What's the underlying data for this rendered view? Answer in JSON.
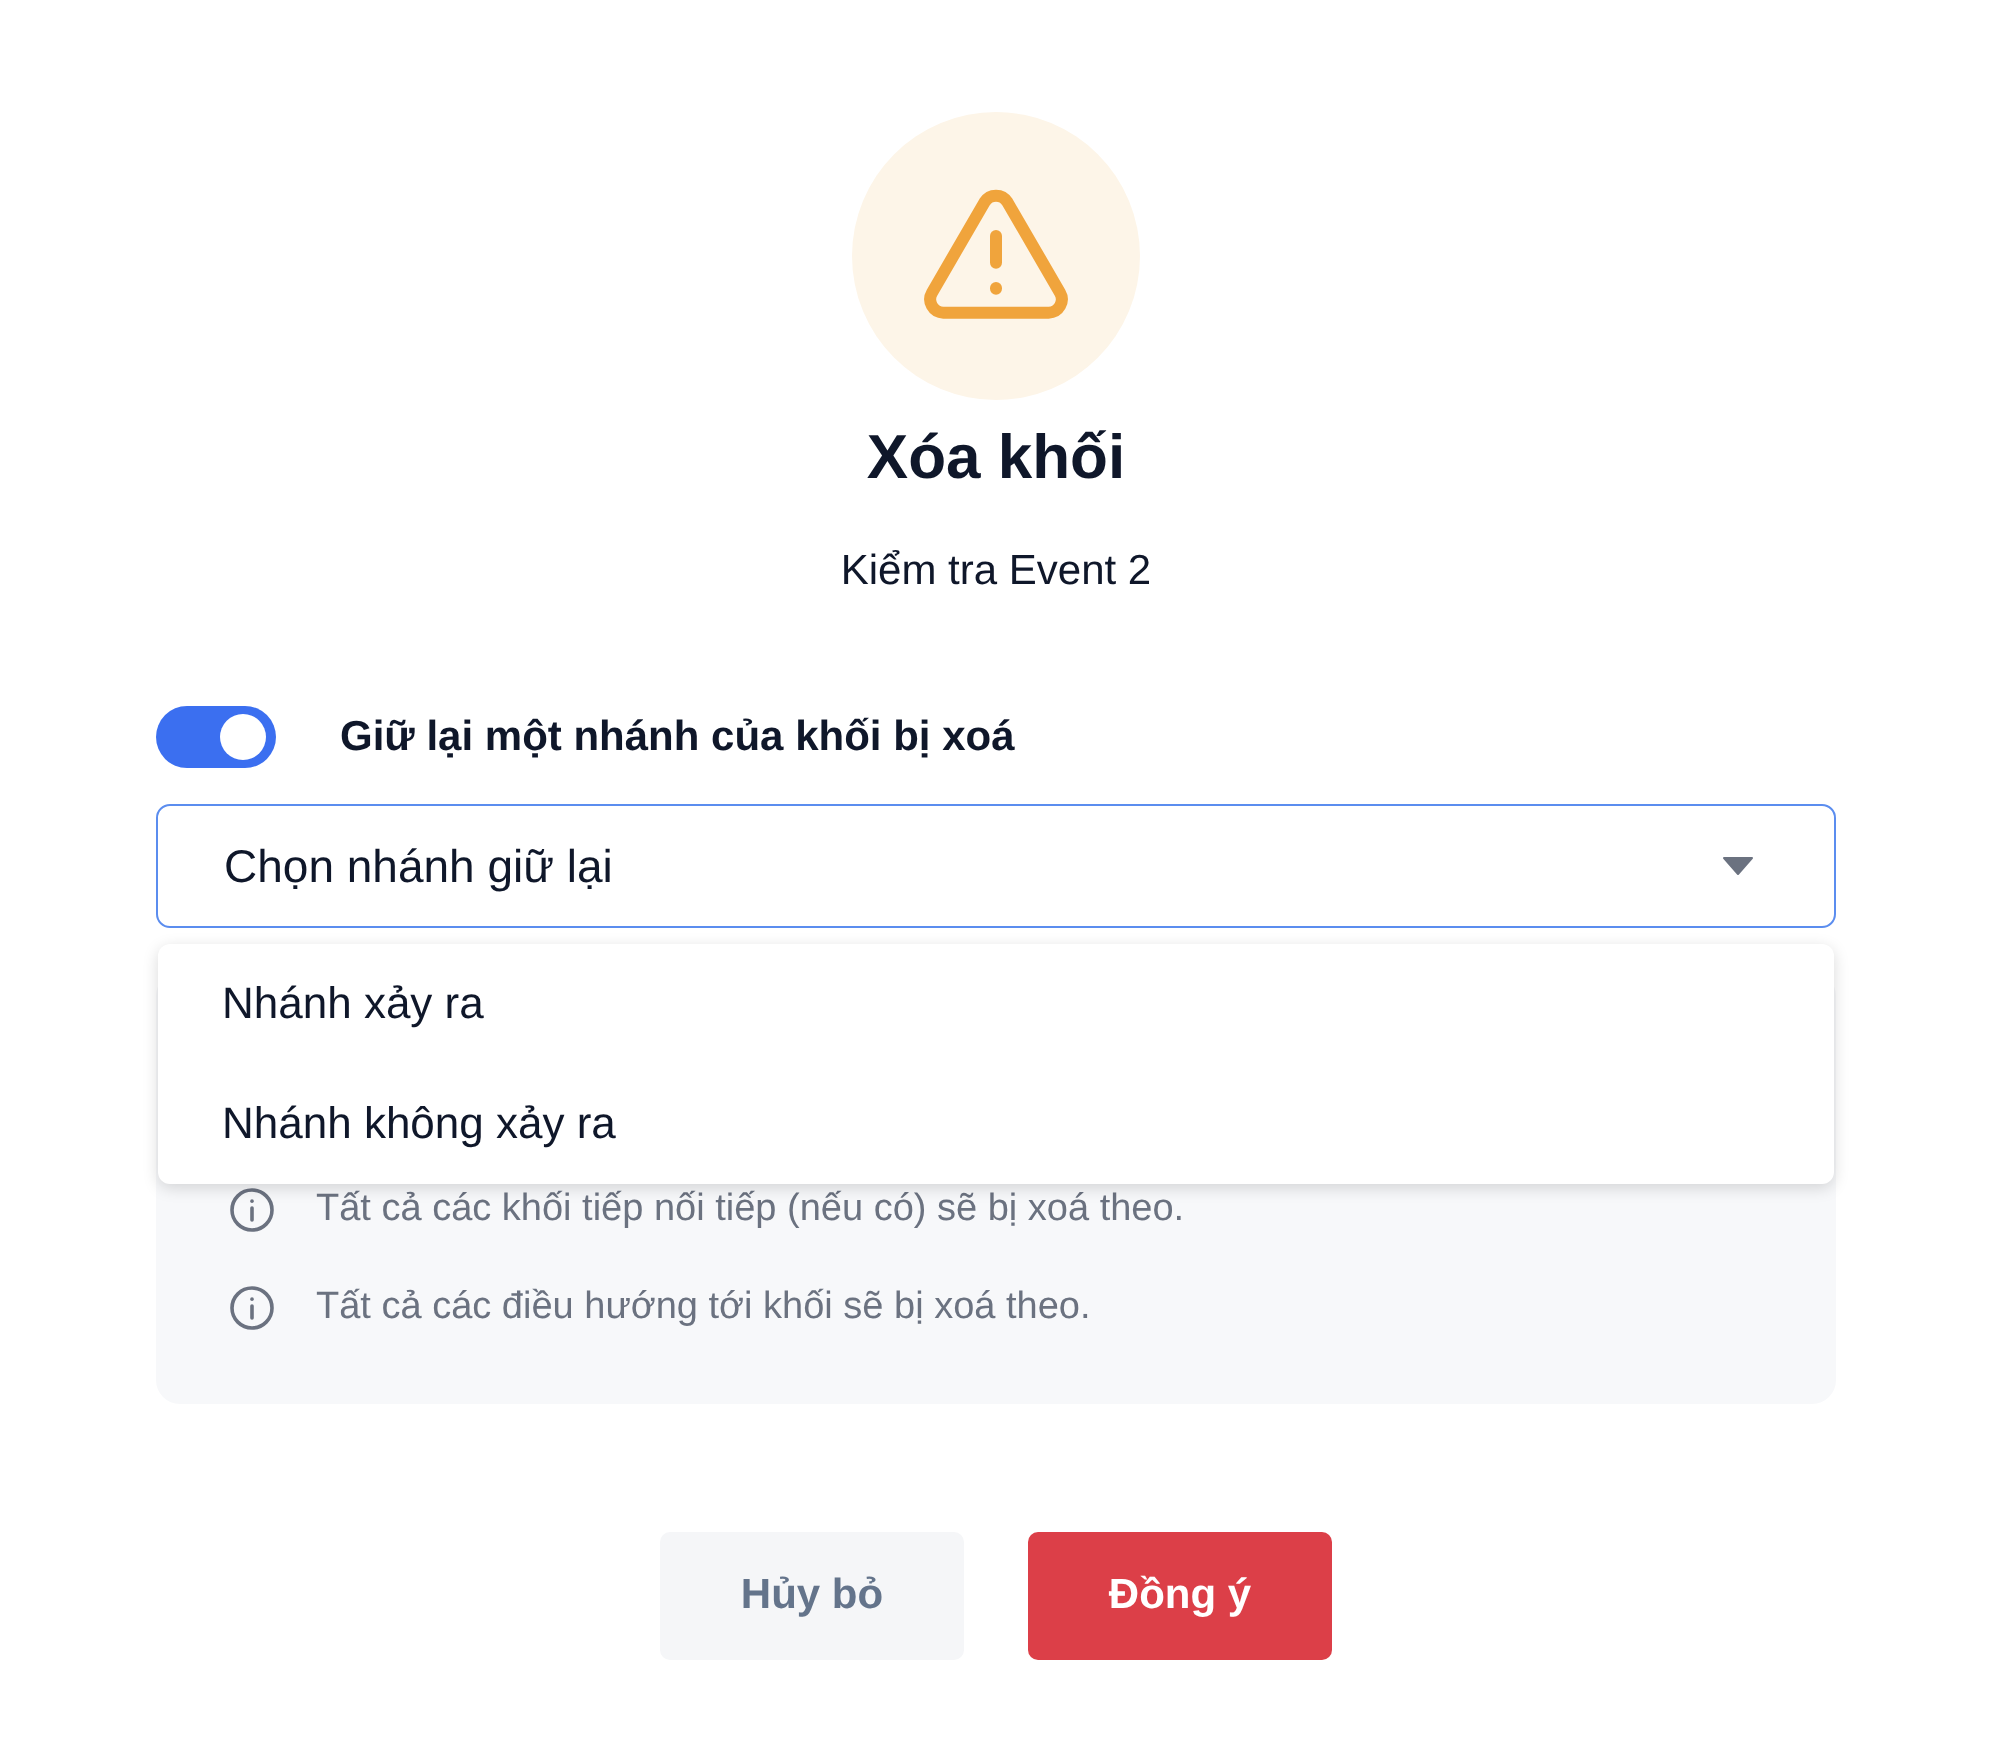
{
  "dialog": {
    "title": "Xóa khối",
    "subtitle": "Kiểm tra Event 2"
  },
  "keep_branch": {
    "label": "Giữ lại một nhánh của khối bị xoá",
    "on": true
  },
  "branch_select": {
    "placeholder": "Chọn nhánh giữ lại",
    "expanded": true,
    "options": [
      {
        "label": "Nhánh xảy ra"
      },
      {
        "label": "Nhánh không xảy ra"
      }
    ]
  },
  "notes": [
    "Tất cả các khối tiếp nối tiếp (nếu có) sẽ bị xoá theo.",
    "Tất cả các điều hướng tới khối sẽ bị xoá theo."
  ],
  "buttons": [
    {
      "label": "Hủy bỏ",
      "kind": "secondary"
    },
    {
      "label": "Đồng ý",
      "kind": "danger"
    }
  ]
}
